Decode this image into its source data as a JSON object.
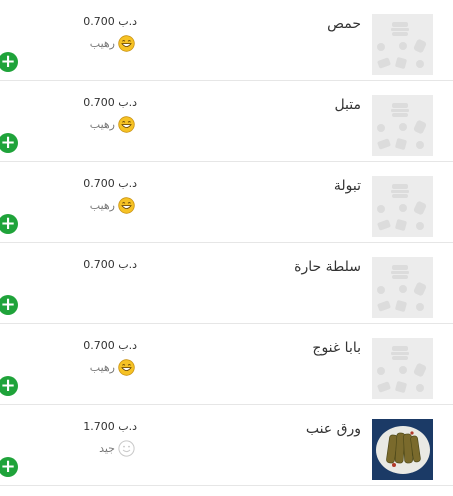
{
  "colors": {
    "add_button": "#1fa33a",
    "divider": "#e6e6e6",
    "placeholder_bg": "#ececec"
  },
  "menu_items": [
    {
      "name": "حمص",
      "price": "د.ب 0.700",
      "rating_label": "رهيب",
      "rating_icon": "happy-face-icon",
      "image": "placeholder"
    },
    {
      "name": "متبل",
      "price": "د.ب 0.700",
      "rating_label": "رهيب",
      "rating_icon": "happy-face-icon",
      "image": "placeholder"
    },
    {
      "name": "تبولة",
      "price": "د.ب 0.700",
      "rating_label": "رهيب",
      "rating_icon": "happy-face-icon",
      "image": "placeholder"
    },
    {
      "name": "سلطة حارة",
      "price": "د.ب 0.700",
      "rating_label": null,
      "rating_icon": null,
      "image": "placeholder"
    },
    {
      "name": "بابا غنوج",
      "price": "د.ب 0.700",
      "rating_label": "رهيب",
      "rating_icon": "happy-face-icon",
      "image": "placeholder"
    },
    {
      "name": "ورق عنب",
      "price": "د.ب 1.700",
      "rating_label": "جيد",
      "rating_icon": "smile-outline-icon",
      "image": "photo"
    }
  ],
  "add_button_icon": "plus-icon"
}
